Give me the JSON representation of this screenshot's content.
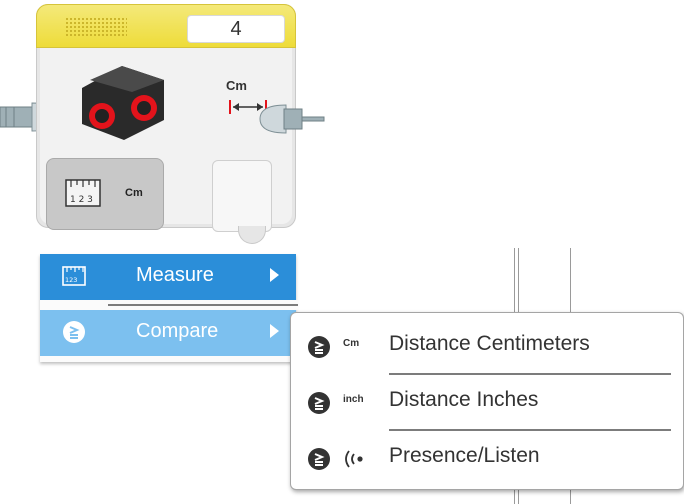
{
  "block": {
    "port": "4",
    "unit_label": "Cm",
    "mode_unit": "Cm"
  },
  "menu": {
    "items": [
      {
        "label": "Measure",
        "icon": "ruler-icon",
        "active": true
      },
      {
        "label": "Compare",
        "icon": "compare-icon",
        "active": false
      }
    ]
  },
  "submenu": {
    "items": [
      {
        "unit": "Cm",
        "label": "Distance Centimeters"
      },
      {
        "unit": "inch",
        "label": "Distance Inches"
      },
      {
        "unit": "",
        "label": "Presence/Listen"
      }
    ]
  },
  "colors": {
    "block_yellow": "#eedc39",
    "menu_active": "#2b8ed9",
    "menu_hover": "#7cc0ef",
    "sensor_red": "#e3131b"
  }
}
